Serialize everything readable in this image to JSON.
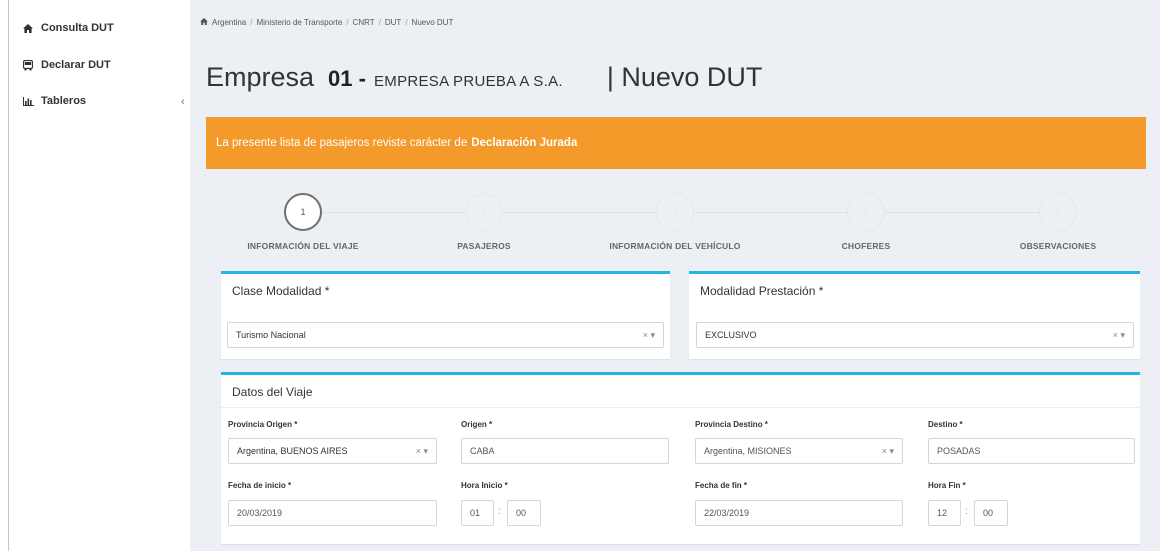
{
  "sidebar": {
    "items": [
      {
        "label": "Consulta DUT",
        "icon": "home-icon"
      },
      {
        "label": "Declarar DUT",
        "icon": "bus-icon"
      },
      {
        "label": "Tableros",
        "icon": "bar-chart-icon"
      }
    ],
    "tableros_chevron": "‹"
  },
  "breadcrumb": [
    "Argentina",
    "Ministerio de Transporte",
    "CNRT",
    "DUT",
    "Nuevo DUT"
  ],
  "header": {
    "empresa_label": "Empresa",
    "empresa_number": "01 -",
    "empresa_name": "EMPRESA PRUEBA A S.A.",
    "page_suffix": "| Nuevo DUT"
  },
  "alert": {
    "text": "La presente lista de pasajeros reviste carácter de",
    "bold": "Declaración Jurada",
    "color": "#f39a2b"
  },
  "stepper": [
    {
      "number": "1",
      "label": "INFORMACIÓN DEL VIAJE",
      "active": true
    },
    {
      "number": "2",
      "label": "PASAJEROS",
      "active": false
    },
    {
      "number": "3",
      "label": "INFORMACIÓN DEL VEHÍCULO",
      "active": false
    },
    {
      "number": "4",
      "label": "CHOFERES",
      "active": false
    },
    {
      "number": "5",
      "label": "OBSERVACIONES",
      "active": false
    }
  ],
  "clase": {
    "title": "Clase Modalidad *",
    "value": "Turismo Nacional"
  },
  "modalidad": {
    "title": "Modalidad Prestación *",
    "value": "EXCLUSIVO"
  },
  "select_controls": "× ▾",
  "viaje": {
    "title": "Datos del Viaje",
    "provincia_origen": {
      "label": "Provincia Origen *",
      "value": "Argentina, BUENOS AIRES"
    },
    "origen": {
      "label": "Origen *",
      "value": "CABA"
    },
    "provincia_destino": {
      "label": "Provincia Destino *",
      "value": "Argentina, MISIONES"
    },
    "destino": {
      "label": "Destino *",
      "value": "POSADAS"
    },
    "fecha_inicio": {
      "label": "Fecha de inicio *",
      "value": "20/03/2019"
    },
    "hora_inicio": {
      "label": "Hora Inicio *",
      "hour": "01",
      "minute": "00"
    },
    "fecha_fin": {
      "label": "Fecha de fin *",
      "value": "22/03/2019"
    },
    "hora_fin": {
      "label": "Hora Fin *",
      "hour": "12",
      "minute": "00"
    },
    "time_separator": ":"
  },
  "colors": {
    "accent": "#27b4e4",
    "alert": "#f39a2b",
    "background": "#ecf0f5"
  }
}
